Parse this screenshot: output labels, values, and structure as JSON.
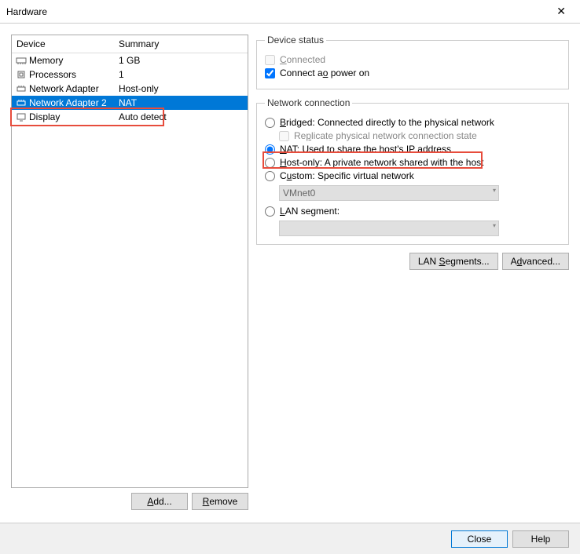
{
  "title": "Hardware",
  "columns": {
    "device": "Device",
    "summary": "Summary"
  },
  "devices": [
    {
      "name": "Memory",
      "summary": "1 GB",
      "icon": "memory"
    },
    {
      "name": "Processors",
      "summary": "1",
      "icon": "cpu"
    },
    {
      "name": "Network Adapter",
      "summary": "Host-only",
      "icon": "net"
    },
    {
      "name": "Network Adapter 2",
      "summary": "NAT",
      "icon": "net",
      "selected": true
    },
    {
      "name": "Display",
      "summary": "Auto detect",
      "icon": "display"
    }
  ],
  "left_buttons": {
    "add": "Add...",
    "remove": "Remove"
  },
  "device_status": {
    "legend": "Device status",
    "connected": "Connected",
    "connected_checked": false,
    "connected_disabled": true,
    "power_on": "Connect at power on",
    "power_on_checked": true
  },
  "network_connection": {
    "legend": "Network connection",
    "bridged": "Bridged: Connected directly to the physical network",
    "replicate": "Replicate physical network connection state",
    "replicate_disabled": true,
    "nat": "NAT: Used to share the host's IP address",
    "hostonly": "Host-only: A private network shared with the host",
    "custom": "Custom: Specific virtual network",
    "custom_combo": "VMnet0",
    "lanseg": "LAN segment:",
    "selected": "nat"
  },
  "right_buttons": {
    "lan": "LAN Segments...",
    "adv": "Advanced..."
  },
  "bottom": {
    "close": "Close",
    "help": "Help"
  },
  "underlines": {
    "add": "A",
    "remove": "R",
    "connected": "C",
    "power_on": "o",
    "bridged": "B",
    "replicate": "p",
    "nat": "N",
    "hostonly": "H",
    "custom": "u",
    "lanseg": "L",
    "lanbtn": "S",
    "adv": "d"
  }
}
